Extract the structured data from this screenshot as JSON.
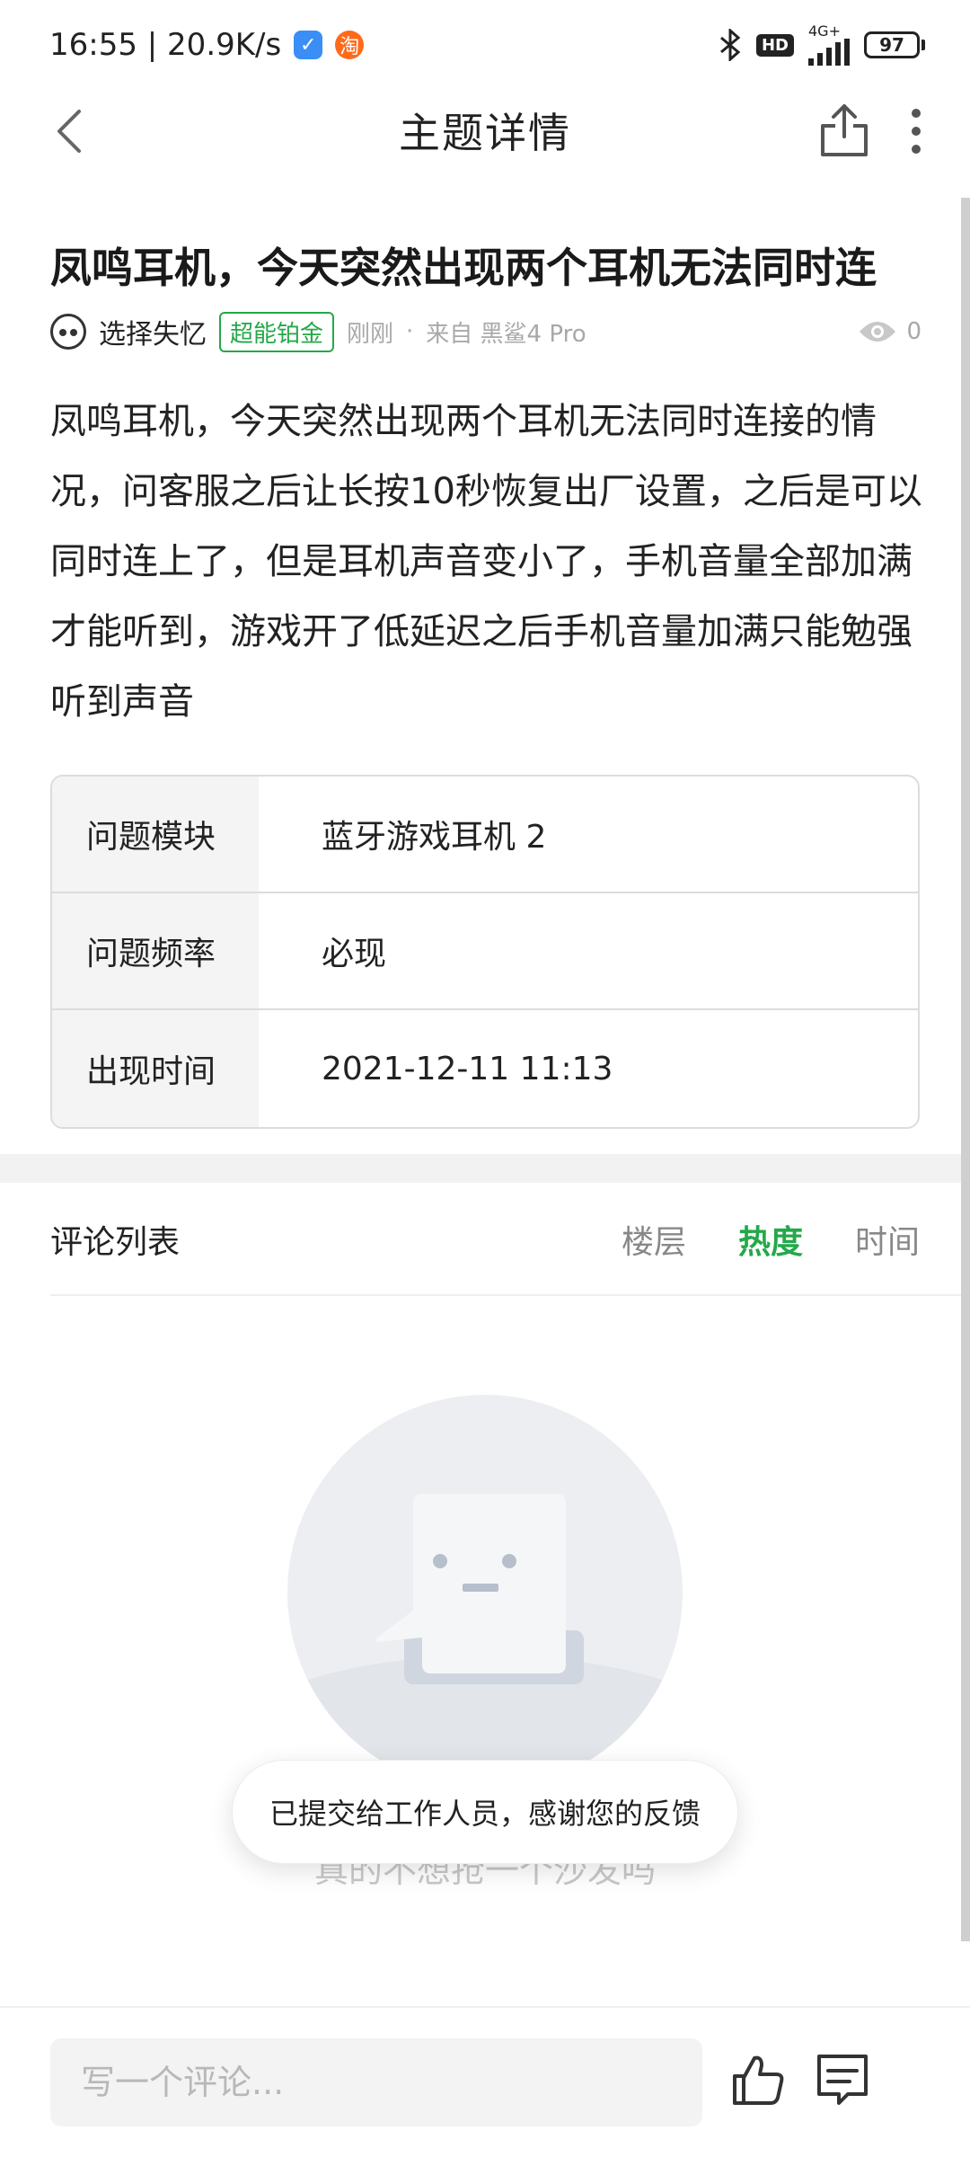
{
  "status_bar": {
    "time_speed": "16:55 | 20.9K/s",
    "hd": "HD",
    "network": "4G+",
    "battery": "97"
  },
  "header": {
    "title": "主题详情"
  },
  "post": {
    "title": "凤鸣耳机，今天突然出现两个耳机无法同时连",
    "author": "选择失忆",
    "level": "超能铂金",
    "time": "刚刚",
    "dot": "·",
    "from": "来自 黑鲨4 Pro",
    "views": "0",
    "body": "凤鸣耳机，今天突然出现两个耳机无法同时连接的情况，问客服之后让长按10秒恢复出厂设置，之后是可以同时连上了，但是耳机声音变小了，手机音量全部加满才能听到，游戏开了低延迟之后手机音量加满只能勉强听到声音"
  },
  "info_table": [
    {
      "key": "问题模块",
      "value": "蓝牙游戏耳机 2"
    },
    {
      "key": "问题频率",
      "value": "必现"
    },
    {
      "key": "出现时间",
      "value": "2021-12-11 11:13"
    }
  ],
  "comments": {
    "title": "评论列表",
    "sort_tabs": [
      {
        "label": "楼层",
        "active": false
      },
      {
        "label": "热度",
        "active": true
      },
      {
        "label": "时间",
        "active": false
      }
    ],
    "empty_text": "真的不想抢一个沙发吗"
  },
  "toast": {
    "text": "已提交给工作人员，感谢您的反馈"
  },
  "bottom_bar": {
    "input_placeholder": "写一个评论..."
  },
  "colors": {
    "accent_green": "#24a84a",
    "muted": "#a8a8a8"
  }
}
